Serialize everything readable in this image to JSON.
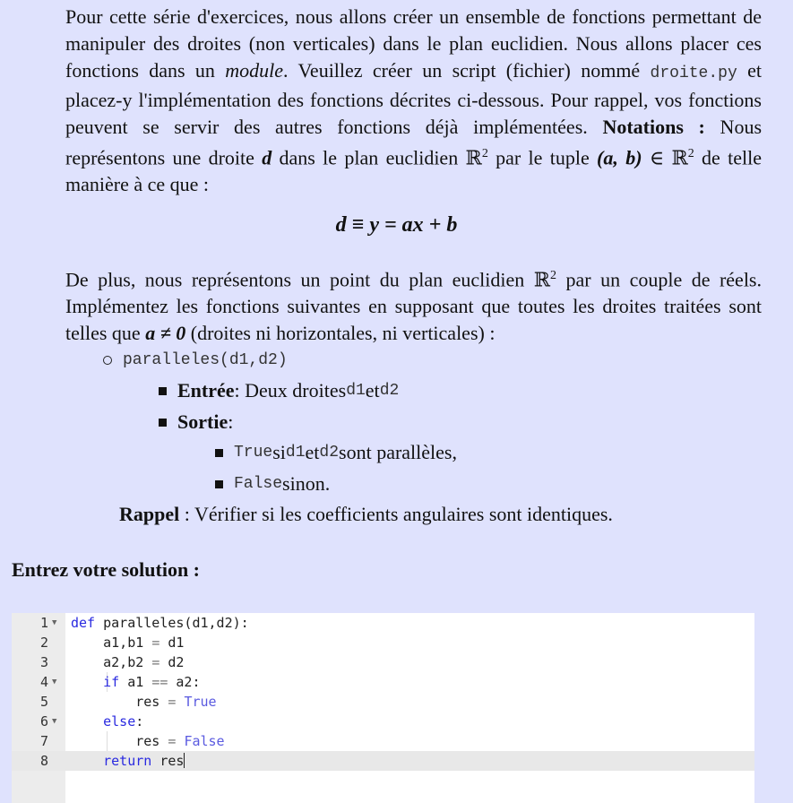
{
  "intro": {
    "p1": "Pour cette série d'exercices, nous allons créer un ensemble de fonctions permettant de manipuler des droites (non verticales) dans le plan euclidien. Nous allons placer ces fonctions dans un ",
    "module_word": "module",
    "p2": ". Veuillez créer un script (fichier) nommé ",
    "filename": "droite.py",
    "p3": " et placez-y l'implémentation des fonctions décrites ci-dessous. Pour rappel, vos fonctions peuvent se servir des autres fonctions déjà implémentées. ",
    "notations_label": "Notations :",
    "p4": " Nous représentons une droite ",
    "d": "d",
    "p5": " dans le plan euclidien ℝ",
    "sup2": "2",
    "p6": " par le tuple ",
    "tuple": "(a, b)",
    "p7": " ∈ ℝ",
    "p8": " de telle manière à ce que :"
  },
  "formula": "d ≡ y = ax + b",
  "para2": {
    "t1": "De plus, nous représentons un point du plan euclidien ℝ",
    "sup2": "2",
    "t2": " par un couple de réels. Implémentez les fonctions suivantes en supposant que toutes les droites traitées sont telles que ",
    "cond": "a ≠ 0",
    "t3": " (droites ni horizontales, ni verticales) :"
  },
  "function_sig": "paralleles(d1,d2)",
  "entree_label": "Entrée",
  "entree_text": " : Deux droites ",
  "d1": "d1",
  "et": " et ",
  "d2": "d2",
  "sortie_label": "Sortie",
  "sortie_colon": " :",
  "true_kw": "True",
  "true_text1": " si ",
  "true_text2": " sont parallèles,",
  "false_kw": "False",
  "false_text": " sinon.",
  "rappel_label": "Rappel",
  "rappel_text": " : Vérifier si les coefficients angulaires sont identiques.",
  "solution_title": "Entrez votre solution :",
  "editor": {
    "l1a": "def",
    "l1b": " paralleles(d1,d2):",
    "l2": "a1,b1 ",
    "l2eq": "=",
    "l2b": " d1",
    "l3": "a2,b2 ",
    "l3eq": "=",
    "l3b": " d2",
    "l4a": "if",
    "l4b": " a1 ",
    "l4eq": "==",
    "l4c": " a2:",
    "l5": "res ",
    "l5eq": "=",
    "l5c": "True",
    "l6": "else",
    "l6b": ":",
    "l7": "res ",
    "l7eq": "=",
    "l7c": "False",
    "l8a": "return",
    "l8b": " res"
  }
}
